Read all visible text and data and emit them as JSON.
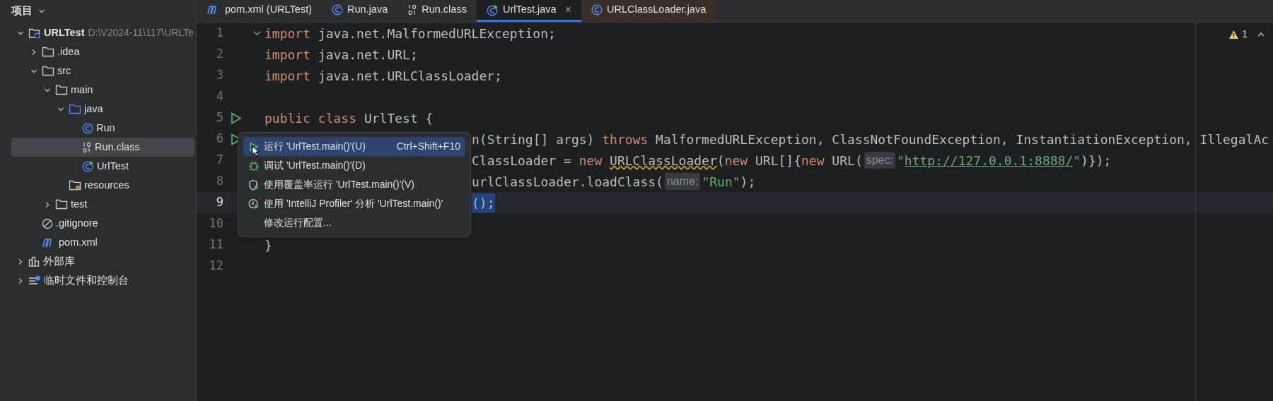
{
  "project_panel": {
    "title": "项目",
    "tree": [
      {
        "label": "URLTest",
        "path": "D:\\V2024-11\\117\\URLTe",
        "kind": "module",
        "expanded": true,
        "selected": false,
        "children": [
          {
            "label": ".idea",
            "kind": "folder",
            "expanded": false,
            "selected": false
          },
          {
            "label": "src",
            "kind": "folder",
            "expanded": true,
            "selected": false,
            "children": [
              {
                "label": "main",
                "kind": "folder",
                "expanded": true,
                "selected": false,
                "children": [
                  {
                    "label": "java",
                    "kind": "source-folder",
                    "expanded": true,
                    "selected": false,
                    "children": [
                      {
                        "label": "Run",
                        "kind": "class",
                        "selected": false
                      },
                      {
                        "label": "Run.class",
                        "kind": "binary",
                        "selected": true
                      },
                      {
                        "label": "UrlTest",
                        "kind": "runnable-class",
                        "selected": false
                      }
                    ]
                  },
                  {
                    "label": "resources",
                    "kind": "resources-folder",
                    "selected": false
                  }
                ]
              },
              {
                "label": "test",
                "kind": "folder",
                "expanded": false,
                "selected": false
              }
            ]
          },
          {
            "label": ".gitignore",
            "kind": "ignore",
            "selected": false
          },
          {
            "label": "pom.xml",
            "kind": "maven",
            "selected": false
          }
        ]
      },
      {
        "label": "外部库",
        "kind": "library",
        "expanded": false,
        "selected": false
      },
      {
        "label": "临时文件和控制台",
        "kind": "scratch",
        "expanded": false,
        "selected": false
      }
    ]
  },
  "tabs": [
    {
      "label": "pom.xml (URLTest)",
      "kind": "maven",
      "selected": false
    },
    {
      "label": "Run.java",
      "kind": "class",
      "selected": false
    },
    {
      "label": "Run.class",
      "kind": "binary",
      "selected": false
    },
    {
      "label": "UrlTest.java",
      "kind": "runnable-class",
      "selected": true,
      "close": "×"
    },
    {
      "label": "URLClassLoader.java",
      "kind": "class",
      "selected": false,
      "tinted": true
    }
  ],
  "editor": {
    "warnings": "1",
    "lines": [
      {
        "number": "1",
        "fold": true,
        "run": false,
        "under_menu": false,
        "current": false,
        "tokens": [
          {
            "kind": "keyword",
            "text": "import"
          },
          {
            "kind": "plain",
            "text": " java.net.MalformedURLException;"
          }
        ]
      },
      {
        "number": "2",
        "fold": false,
        "run": false,
        "under_menu": false,
        "current": false,
        "tokens": [
          {
            "kind": "keyword",
            "text": "import"
          },
          {
            "kind": "plain",
            "text": " java.net.URL;"
          }
        ]
      },
      {
        "number": "3",
        "fold": false,
        "run": false,
        "under_menu": false,
        "current": false,
        "tokens": [
          {
            "kind": "keyword",
            "text": "import"
          },
          {
            "kind": "plain",
            "text": " java.net.URLClassLoader;"
          }
        ]
      },
      {
        "number": "4",
        "fold": false,
        "run": false,
        "current": false
      },
      {
        "number": "5",
        "fold": false,
        "run": true,
        "under_menu": false,
        "current": false,
        "tokens": [
          {
            "kind": "keyword",
            "text": "public class"
          },
          {
            "kind": "plain",
            "text": " UrlTest {"
          }
        ]
      },
      {
        "number": "6",
        "fold": false,
        "run": true,
        "under_menu": true,
        "current": false,
        "tokens": [
          {
            "kind": "plain",
            "text": "n(String[] args) "
          },
          {
            "kind": "keyword",
            "text": "throws"
          },
          {
            "kind": "plain",
            "text": " MalformedURLException, ClassNotFoundException, InstantiationException, IllegalAc"
          }
        ]
      },
      {
        "number": "7",
        "fold": false,
        "run": false,
        "under_menu": true,
        "current": false,
        "tokens": [
          {
            "kind": "plain",
            "text": "ClassLoader = "
          },
          {
            "kind": "keyword",
            "text": "new "
          },
          {
            "kind": "warning",
            "text": "URLClassLoader"
          },
          {
            "kind": "plain",
            "text": "("
          },
          {
            "kind": "keyword",
            "text": "new"
          },
          {
            "kind": "plain",
            "text": " URL[]{"
          },
          {
            "kind": "keyword",
            "text": "new"
          },
          {
            "kind": "plain",
            "text": " URL("
          },
          {
            "kind": "hint",
            "text": "spec:"
          },
          {
            "kind": "string",
            "text": "\""
          },
          {
            "kind": "link",
            "text": "http://127.0.0.1:8888/"
          },
          {
            "kind": "string",
            "text": "\""
          },
          {
            "kind": "plain",
            "text": ")});"
          }
        ]
      },
      {
        "number": "8",
        "fold": false,
        "run": false,
        "under_menu": true,
        "current": false,
        "tokens": [
          {
            "kind": "plain",
            "text": "urlClassLoader.loadClass("
          },
          {
            "kind": "hint",
            "text": "name:"
          },
          {
            "kind": "string",
            "text": "\"Run\""
          },
          {
            "kind": "plain",
            "text": ");"
          }
        ]
      },
      {
        "number": "9",
        "fold": false,
        "run": false,
        "under_menu": true,
        "current": true,
        "tokens": [
          {
            "kind": "selection",
            "text": "();"
          }
        ]
      },
      {
        "number": "10",
        "fold": false,
        "run": false,
        "current": false
      },
      {
        "number": "11",
        "fold": false,
        "run": false,
        "under_menu": false,
        "current": false,
        "tokens": [
          {
            "kind": "plain",
            "text": "}"
          }
        ]
      },
      {
        "number": "12",
        "fold": false,
        "run": false,
        "current": false
      }
    ]
  },
  "context_menu": [
    {
      "kind": "run",
      "label": "运行 'UrlTest.main()'(U)",
      "shortcut": "Ctrl+Shift+F10",
      "selected": true
    },
    {
      "kind": "debug",
      "label": "调试 'UrlTest.main()'(D)",
      "selected": false
    },
    {
      "kind": "coverage",
      "label": "使用覆盖率运行 'UrlTest.main()'(V)",
      "selected": false
    },
    {
      "kind": "profiler",
      "label": "使用 'IntelliJ Profiler' 分析  'UrlTest.main()'",
      "selected": false
    },
    {
      "kind": "plain",
      "label": "修改运行配置...",
      "selected": false
    }
  ]
}
